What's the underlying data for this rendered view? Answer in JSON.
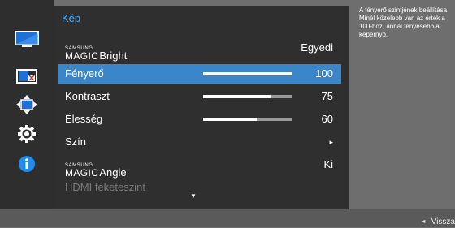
{
  "menu": {
    "title": "Kép",
    "rows": [
      {
        "brand_top": "SAMSUNG",
        "brand_bottom": "MAGIC",
        "label": "Bright",
        "value": "Egyedi"
      },
      {
        "label": "Fényerő",
        "value": "100",
        "level": 100,
        "selected": true
      },
      {
        "label": "Kontraszt",
        "value": "75",
        "level": 75
      },
      {
        "label": "Élesség",
        "value": "60",
        "level": 60
      },
      {
        "label": "Szín",
        "value": "▸"
      },
      {
        "brand_top": "SAMSUNG",
        "brand_bottom": "MAGIC",
        "label": "Angle",
        "value": "Ki"
      },
      {
        "label": "HDMI feketeszint",
        "disabled": true
      }
    ],
    "scroll_indicator": "▼"
  },
  "help": {
    "text": "A fényerő szintjének beállítása. Minél közelebb van az érték a 100-hoz, annál fényesebb a képernyő."
  },
  "footer": {
    "back_arrow": "◄",
    "back_label": "Vissza"
  },
  "rail": {
    "icons": [
      "monitor-icon",
      "picture-in-picture-icon",
      "position-arrows-icon",
      "settings-gear-icon",
      "info-icon"
    ]
  },
  "colors": {
    "accent": "#4fb0ff",
    "selected_row": "#3b86c9",
    "panel": "#2f2f2f"
  }
}
